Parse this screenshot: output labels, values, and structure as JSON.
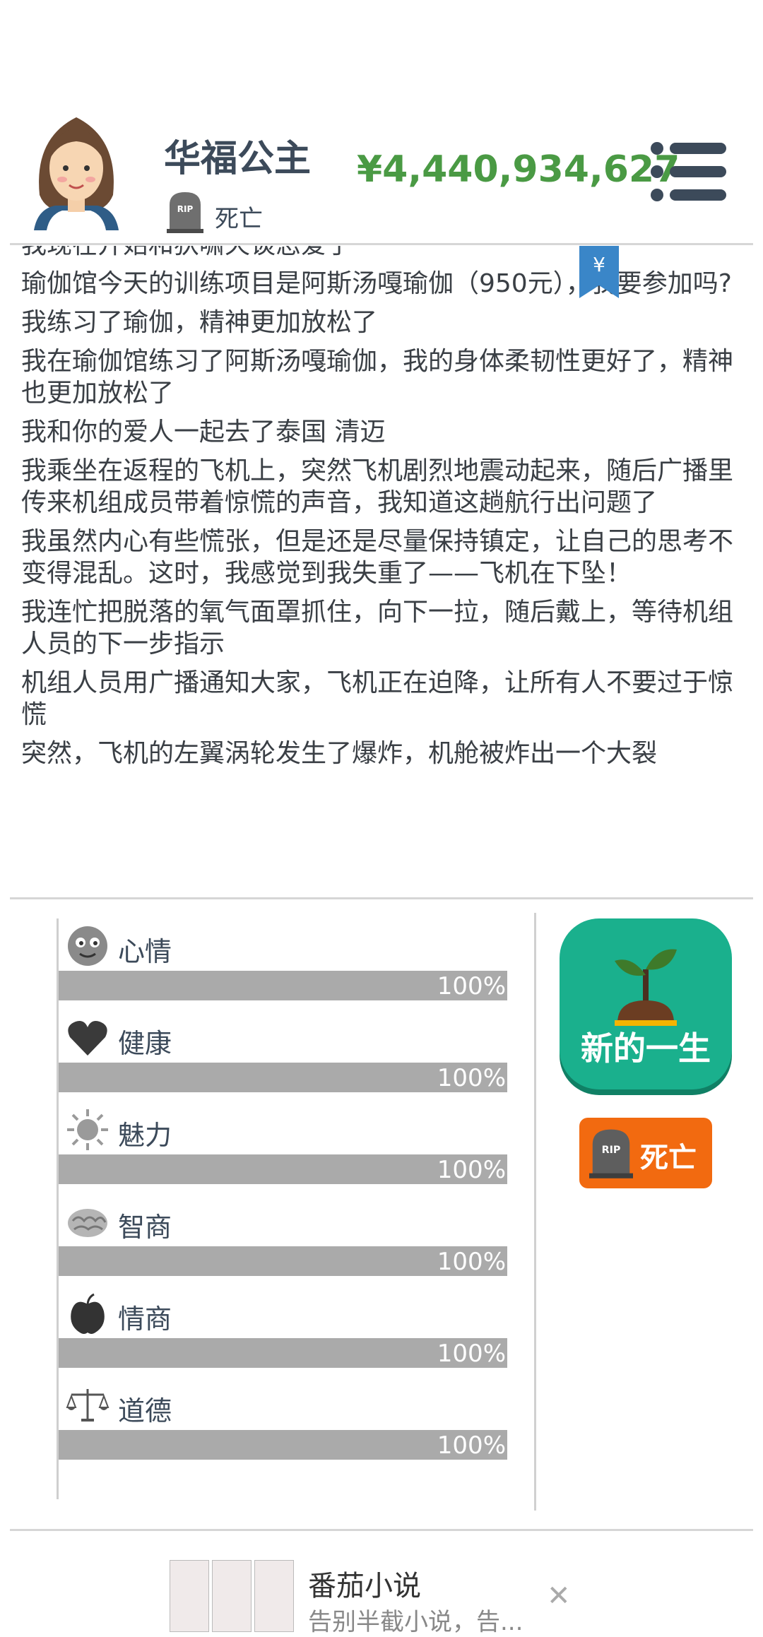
{
  "profile": {
    "name": "华福公主",
    "status": "死亡",
    "money": "¥4,440,934,627"
  },
  "log": [
    "我现在开始和狄啸天谈恋爱了",
    "瑜伽馆今天的训练项目是阿斯汤嘎瑜伽（950元），我要参加吗?",
    "我练习了瑜伽，精神更加放松了",
    "我在瑜伽馆练习了阿斯汤嘎瑜伽，我的身体柔韧性更好了，精神也更加放松了",
    "我和你的爱人一起去了泰国 清迈",
    "我乘坐在返程的飞机上，突然飞机剧烈地震动起来，随后广播里传来机组成员带着惊慌的声音，我知道这趟航行出问题了",
    "我虽然内心有些慌张，但是还是尽量保持镇定，让自己的思考不变得混乱。这时，我感觉到我失重了——飞机在下坠！",
    "我连忙把脱落的氧气面罩抓住，向下一拉，随后戴上，等待机组人员的下一步指示",
    "机组人员用广播通知大家，飞机正在迫降，让所有人不要过于惊慌",
    "突然，飞机的左翼涡轮发生了爆炸，机舱被炸出一个大裂"
  ],
  "bookmark_symbol": "¥",
  "stats": [
    {
      "label": "心情",
      "percent": 100,
      "display": "100%",
      "icon": "smiley-face-icon"
    },
    {
      "label": "健康",
      "percent": 100,
      "display": "100%",
      "icon": "heart-icon"
    },
    {
      "label": "魅力",
      "percent": 100,
      "display": "100%",
      "icon": "sun-icon"
    },
    {
      "label": "智商",
      "percent": 100,
      "display": "100%",
      "icon": "brain-icon"
    },
    {
      "label": "情商",
      "percent": 100,
      "display": "100%",
      "icon": "apple-icon"
    },
    {
      "label": "道德",
      "percent": 100,
      "display": "100%",
      "icon": "scales-icon"
    }
  ],
  "buttons": {
    "new_life": "新的一生",
    "death": "死亡"
  },
  "ad": {
    "title": "番茄小说",
    "subtitle": "告别半截小说，告..."
  },
  "colors": {
    "money": "#4a9a44",
    "new_life_bg": "#1ab08d",
    "death_bg": "#f26a10",
    "bar_fill": "#aaaaaa"
  }
}
